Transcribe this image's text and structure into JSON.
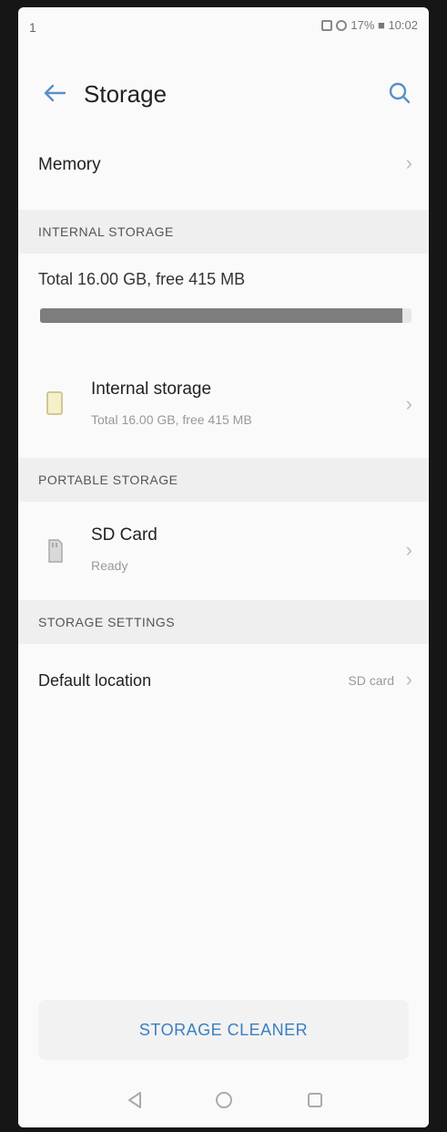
{
  "status_bar": {
    "left_text": "1",
    "right_text": "17% ■ 10:02"
  },
  "app_bar": {
    "title": "Storage",
    "back_icon": "arrow-left-icon",
    "search_icon": "search-icon"
  },
  "memory_row": {
    "label": "Memory"
  },
  "internal_section": {
    "header": "INTERNAL STORAGE",
    "total_text": "Total 16.00 GB, free 415 MB",
    "usage_fraction": 0.975
  },
  "internal_item": {
    "title": "Internal storage",
    "subtitle": "Total 16.00 GB, free 415 MB"
  },
  "portable_section": {
    "header": "PORTABLE STORAGE"
  },
  "sd_item": {
    "title": "SD Card",
    "subtitle": "Ready"
  },
  "settings_section": {
    "header": "STORAGE SETTINGS"
  },
  "default_location": {
    "label": "Default location",
    "value": "SD card"
  },
  "cleaner_button": {
    "label": "STORAGE CLEANER"
  },
  "colors": {
    "accent": "#3a7fc1",
    "progress": "#7d7d7d",
    "section_bg": "#efefef"
  }
}
